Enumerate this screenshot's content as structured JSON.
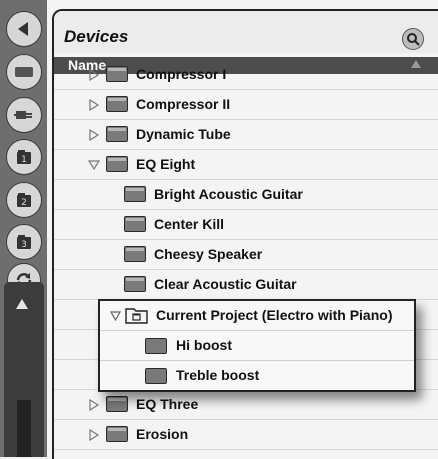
{
  "browser": {
    "title": "Devices",
    "column_header": "Name",
    "search_icon": "search-icon"
  },
  "sidebar": {
    "buttons": [
      {
        "name": "back-icon"
      },
      {
        "name": "hide-icon"
      },
      {
        "name": "plugin-icon"
      },
      {
        "name": "place-1-icon"
      },
      {
        "name": "place-2-icon"
      },
      {
        "name": "place-3-icon"
      },
      {
        "name": "refresh-icon"
      }
    ]
  },
  "list": {
    "rows": [
      {
        "label": "Compressor I",
        "level": 1,
        "expander": "collapsed"
      },
      {
        "label": "Compressor II",
        "level": 1,
        "expander": "collapsed"
      },
      {
        "label": "Dynamic Tube",
        "level": 1,
        "expander": "collapsed"
      },
      {
        "label": "EQ Eight",
        "level": 1,
        "expander": "expanded"
      },
      {
        "label": "Bright Acoustic Guitar",
        "level": 2
      },
      {
        "label": "Center Kill",
        "level": 2
      },
      {
        "label": "Cheesy Speaker",
        "level": 2
      },
      {
        "label": "Clear Acoustic Guitar",
        "level": 2
      },
      {
        "label": "",
        "level": 2
      },
      {
        "label": "",
        "level": 2
      },
      {
        "label": "",
        "level": 2
      },
      {
        "label": "EQ Three",
        "level": 1,
        "expander": "collapsed"
      },
      {
        "label": "Erosion",
        "level": 1,
        "expander": "collapsed"
      }
    ]
  },
  "popup": {
    "folder_label": "Current Project (Electro with Piano)",
    "items": [
      "Hi boost",
      "Treble boost"
    ]
  },
  "colors": {
    "sidebar": "#6e6e6e",
    "header_bar": "#4d4d4d",
    "panel": "#f4f4f4"
  }
}
